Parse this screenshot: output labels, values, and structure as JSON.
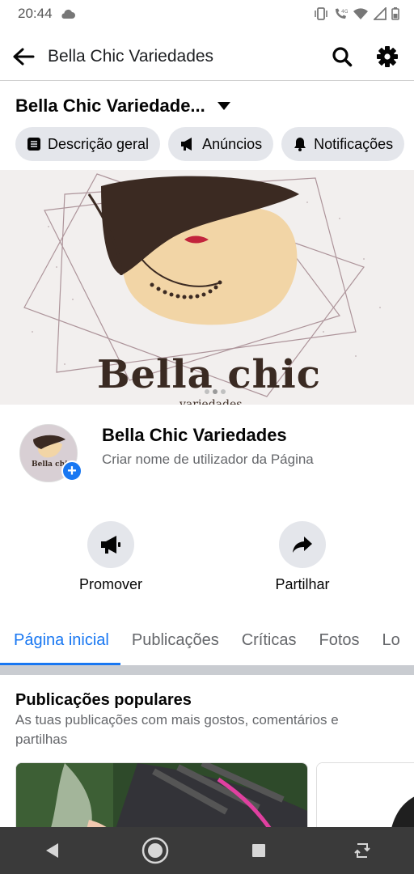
{
  "status_bar": {
    "time": "20:44",
    "network": "4G"
  },
  "app_bar": {
    "title": "Bella Chic Variedades"
  },
  "page_selector": {
    "name": "Bella Chic Variedade..."
  },
  "chips": [
    {
      "label": "Descrição geral",
      "icon": "list-icon"
    },
    {
      "label": "Anúncios",
      "icon": "megaphone-icon"
    },
    {
      "label": "Notificações",
      "icon": "bell-icon"
    }
  ],
  "cover": {
    "logo_text": "Bella chic",
    "logo_subtext": "variedades"
  },
  "profile": {
    "name": "Bella Chic Variedades",
    "subtitle": "Criar nome de utilizador da Página",
    "avatar_text": "Bella chic"
  },
  "actions": [
    {
      "label": "Promover",
      "icon": "megaphone-icon"
    },
    {
      "label": "Partilhar",
      "icon": "share-arrow-icon"
    }
  ],
  "tabs": [
    {
      "label": "Página inicial",
      "active": true
    },
    {
      "label": "Publicações",
      "active": false
    },
    {
      "label": "Críticas",
      "active": false
    },
    {
      "label": "Fotos",
      "active": false
    },
    {
      "label": "Lo",
      "active": false
    }
  ],
  "popular": {
    "title": "Publicações populares",
    "subtitle": "As tuas publicações com mais gostos, comentários e partilhas"
  },
  "colors": {
    "accent": "#1877f2",
    "chip_bg": "#e4e6eb",
    "nav_bg": "#3a3a3a"
  }
}
